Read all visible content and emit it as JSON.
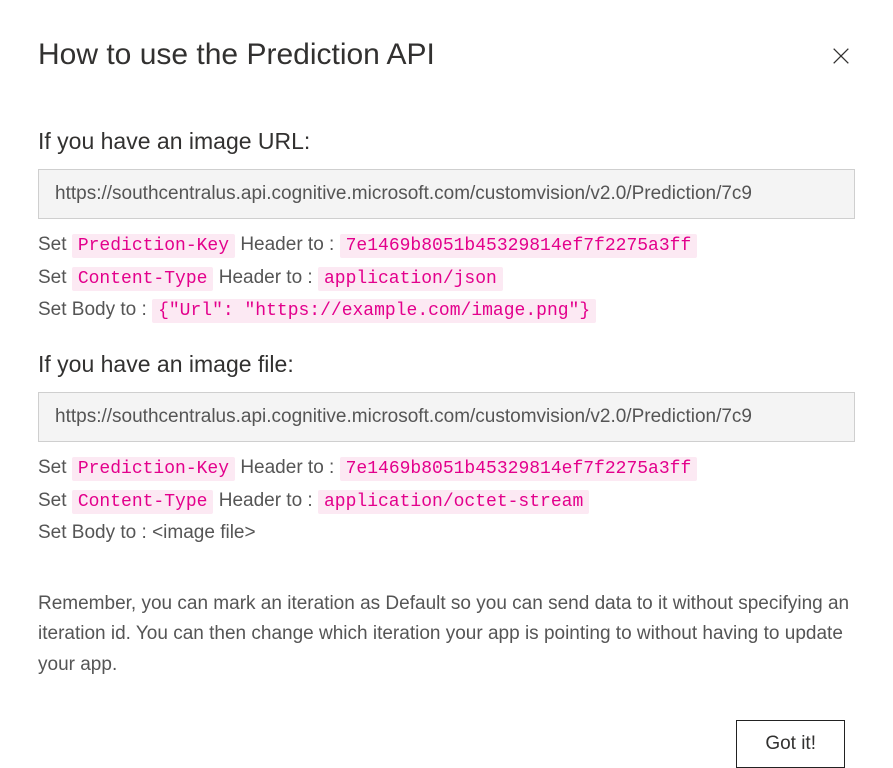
{
  "dialog": {
    "title": "How to use the Prediction API",
    "close_label": "Close"
  },
  "section_url": {
    "heading": "If you have an image URL:",
    "endpoint": "https://southcentralus.api.cognitive.microsoft.com/customvision/v2.0/Prediction/7c9",
    "line1_prefix": "Set ",
    "line1_header": "Prediction-Key",
    "line1_mid": " Header to : ",
    "line1_value": "7e1469b8051b45329814ef7f2275a3ff",
    "line2_prefix": "Set ",
    "line2_header": "Content-Type",
    "line2_mid": " Header to : ",
    "line2_value": "application/json",
    "line3_prefix": "Set Body to : ",
    "line3_value": "{\"Url\": \"https://example.com/image.png\"}"
  },
  "section_file": {
    "heading": "If you have an image file:",
    "endpoint": "https://southcentralus.api.cognitive.microsoft.com/customvision/v2.0/Prediction/7c9",
    "line1_prefix": "Set ",
    "line1_header": "Prediction-Key",
    "line1_mid": " Header to : ",
    "line1_value": "7e1469b8051b45329814ef7f2275a3ff",
    "line2_prefix": "Set ",
    "line2_header": "Content-Type",
    "line2_mid": " Header to : ",
    "line2_value": "application/octet-stream",
    "line3_text": "Set Body to : <image file>"
  },
  "footer": {
    "note": "Remember, you can mark an iteration as Default so you can send data to it without specifying an iteration id. You can then change which iteration your app is pointing to without having to update your app.",
    "button_label": "Got it!"
  }
}
